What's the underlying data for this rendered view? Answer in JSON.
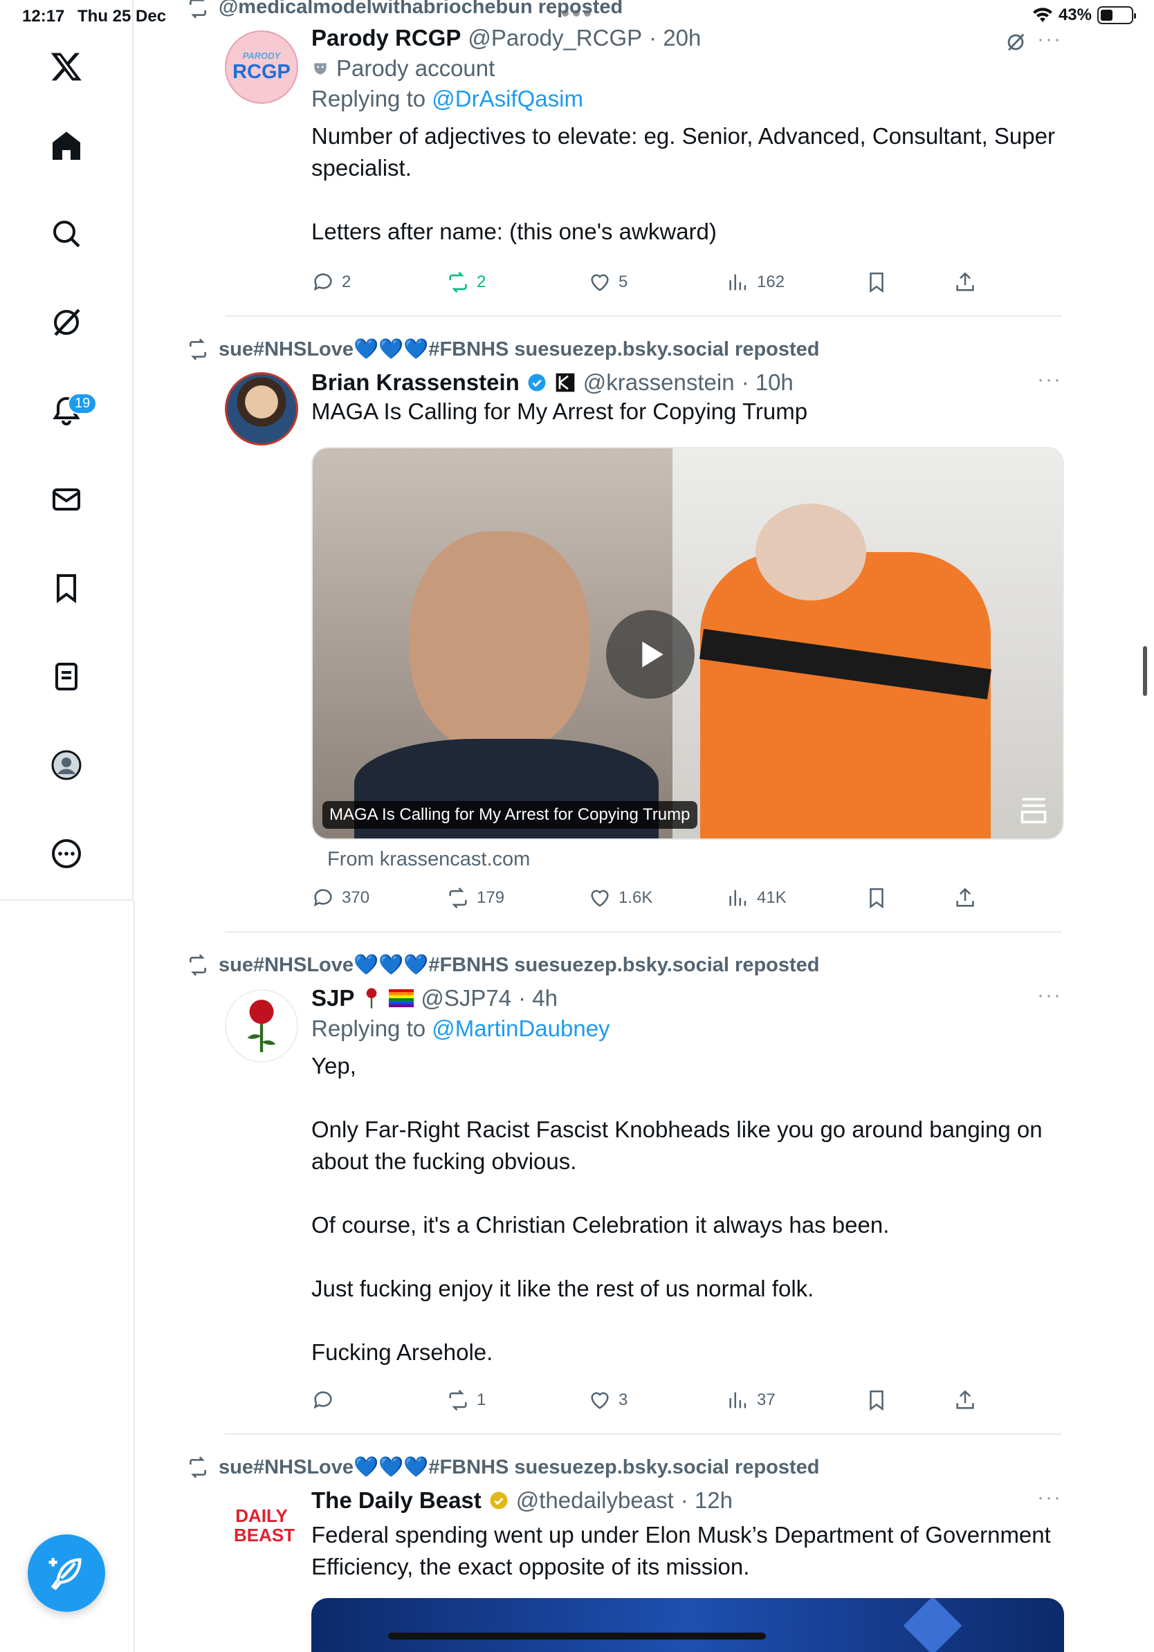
{
  "status": {
    "time": "12:17",
    "date": "Thu 25 Dec",
    "battery": "43%",
    "battery_level": 0.43
  },
  "sidebar": {
    "items": [
      {
        "name": "x-logo"
      },
      {
        "name": "home"
      },
      {
        "name": "search"
      },
      {
        "name": "grok"
      },
      {
        "name": "notifications",
        "badge": "19"
      },
      {
        "name": "messages"
      },
      {
        "name": "bookmarks"
      },
      {
        "name": "lists"
      },
      {
        "name": "profile"
      },
      {
        "name": "more"
      }
    ],
    "compose_icon": "feather-plus-icon"
  },
  "feed": {
    "tweet1": {
      "repost": "@medicalmodelwithabriochebun reposted",
      "name": "Parody RCGP",
      "handle": "@Parody_RCGP",
      "time": "· 20h",
      "sub": "Parody account",
      "reply_prefix": "Replying to ",
      "reply_to": "@DrAsifQasim",
      "avatar_top": "PARODY",
      "avatar_main": "RCGP",
      "body": [
        "Number of adjectives to elevate: eg. Senior, Advanced, Consultant, Super specialist.",
        "Letters after name: (this one's awkward)"
      ],
      "replies": "2",
      "reposts": "2",
      "likes": "5",
      "views": "162"
    },
    "tweet2": {
      "repost": "sue#NHSLove💙💙💙#FBNHS suesuezep.bsky.social reposted",
      "name": "Brian Krassenstein",
      "handle": "@krassenstein",
      "time": "· 10h",
      "body": "MAGA Is Calling for My Arrest for Copying Trump",
      "video_caption": "MAGA Is Calling for My Arrest for Copying Trump",
      "source": "From krassencast.com",
      "replies": "370",
      "reposts": "179",
      "likes": "1.6K",
      "views": "41K"
    },
    "tweet3": {
      "repost": "sue#NHSLove💙💙💙#FBNHS suesuezep.bsky.social reposted",
      "name": "SJP",
      "handle": "@SJP74",
      "time": "· 4h",
      "reply_prefix": "Replying to ",
      "reply_to": "@MartinDaubney",
      "body": [
        "Yep,",
        "Only Far-Right Racist Fascist Knobheads like you go around banging on about the fucking obvious.",
        "Of course, it's a Christian Celebration it always has been.",
        "Just fucking enjoy it like the rest of us normal folk.",
        "Fucking Arsehole."
      ],
      "replies": "",
      "reposts": "1",
      "likes": "3",
      "views": "37"
    },
    "tweet4": {
      "repost": "sue#NHSLove💙💙💙#FBNHS suesuezep.bsky.social reposted",
      "name": "The Daily Beast",
      "handle": "@thedailybeast",
      "time": "· 12h",
      "avatar_text": "DAILY BEAST",
      "body": "Federal spending went up under Elon Musk’s Department of Government Efficiency, the exact opposite of its mission."
    }
  },
  "colors": {
    "accent": "#1d9bf0",
    "repost_green": "#00ba7c",
    "muted": "#536471"
  }
}
